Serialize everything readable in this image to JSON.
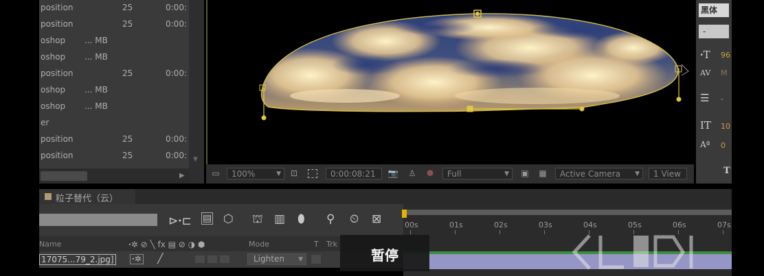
{
  "project": {
    "rows": [
      {
        "name": "position",
        "size": "",
        "fps": "25",
        "dur": "0:00:"
      },
      {
        "name": "position",
        "size": "",
        "fps": "25",
        "dur": "0:00:"
      },
      {
        "name": "oshop",
        "size": "... MB",
        "fps": "",
        "dur": ""
      },
      {
        "name": "oshop",
        "size": "... MB",
        "fps": "",
        "dur": ""
      },
      {
        "name": "position",
        "size": "",
        "fps": "25",
        "dur": "0:00:"
      },
      {
        "name": "oshop",
        "size": "... MB",
        "fps": "",
        "dur": ""
      },
      {
        "name": "oshop",
        "size": "... MB",
        "fps": "",
        "dur": ""
      },
      {
        "name": "er",
        "size": "",
        "fps": "",
        "dur": ""
      },
      {
        "name": "position",
        "size": "",
        "fps": "25",
        "dur": "0:00:"
      },
      {
        "name": "position",
        "size": "",
        "fps": "25",
        "dur": "0:00:"
      }
    ]
  },
  "viewer_toolbar": {
    "zoom": "100%",
    "timecode": "0:00:08:21",
    "resolution": "Full",
    "camera": "Active Camera",
    "views": "1 View"
  },
  "character": {
    "font": "黑体",
    "style": "-",
    "font_size_value": "96",
    "tracking_value": "M",
    "stroke_value": "- ",
    "vscale_value": "10",
    "baseline_value": "0"
  },
  "timeline": {
    "comp_tab": "粒子替代（云）",
    "ruler_ticks": [
      "00s",
      "01s",
      "02s",
      "03s",
      "04s",
      "05s",
      "06s",
      "07s"
    ],
    "col_name": "Name",
    "col_mode": "Mode",
    "col_t": "T",
    "col_trkmat": "Trk",
    "layer_name": "17075...79_2.jpg]",
    "layer_mode": "Lighten"
  },
  "overlay": {
    "pause_label": "暂停"
  },
  "colors": {
    "accent_yellow": "#e2b400",
    "track_purple": "#9595c6",
    "track_green": "#3b8f3b"
  }
}
